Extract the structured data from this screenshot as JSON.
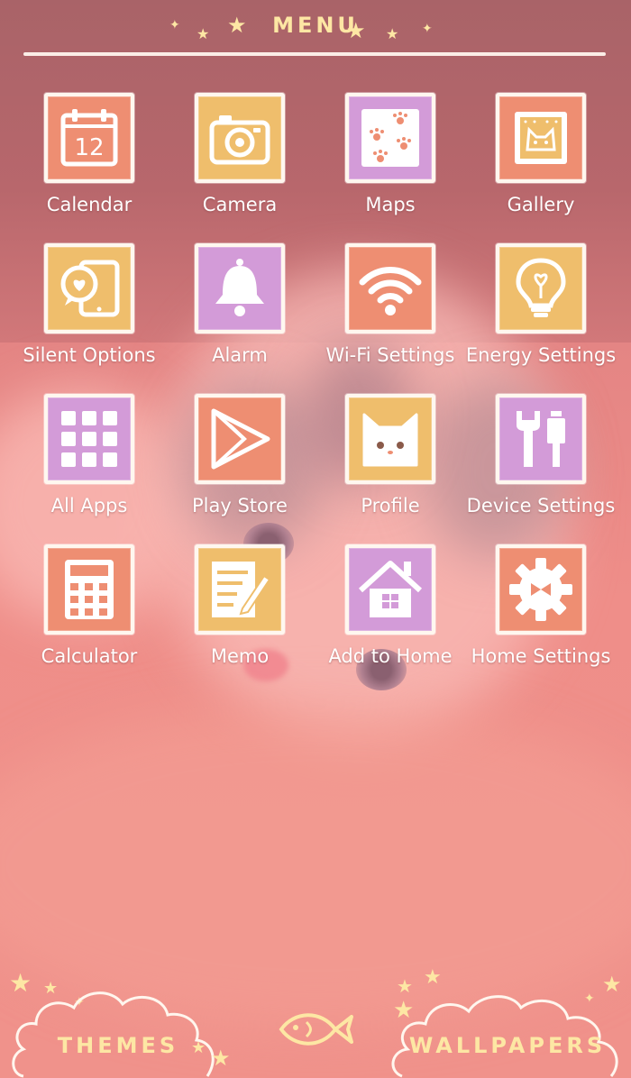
{
  "header": {
    "title": "MENU"
  },
  "apps": [
    {
      "label": "Calendar",
      "icon": "calendar-icon",
      "color": "coral"
    },
    {
      "label": "Camera",
      "icon": "camera-icon",
      "color": "yellow"
    },
    {
      "label": "Maps",
      "icon": "paw-prints-icon",
      "color": "purple"
    },
    {
      "label": "Gallery",
      "icon": "cat-picture-icon",
      "color": "coral"
    },
    {
      "label": "Silent Options",
      "icon": "phone-heart-icon",
      "color": "yellow"
    },
    {
      "label": "Alarm",
      "icon": "bell-icon",
      "color": "purple"
    },
    {
      "label": "Wi-Fi Settings",
      "icon": "wifi-icon",
      "color": "coral"
    },
    {
      "label": "Energy Settings",
      "icon": "lightbulb-icon",
      "color": "yellow"
    },
    {
      "label": "All Apps",
      "icon": "app-grid-icon",
      "color": "purple"
    },
    {
      "label": "Play Store",
      "icon": "play-store-icon",
      "color": "coral"
    },
    {
      "label": "Profile",
      "icon": "cat-face-icon",
      "color": "yellow"
    },
    {
      "label": "Device Settings",
      "icon": "tools-icon",
      "color": "purple"
    },
    {
      "label": "Calculator",
      "icon": "calculator-icon",
      "color": "coral"
    },
    {
      "label": "Memo",
      "icon": "memo-pencil-icon",
      "color": "yellow"
    },
    {
      "label": "Add to Home",
      "icon": "house-icon",
      "color": "purple"
    },
    {
      "label": "Home Settings",
      "icon": "gear-icon",
      "color": "coral"
    }
  ],
  "calendar_date": "12",
  "footer": {
    "themes_label": "THEMES",
    "wallpapers_label": "WALLPAPERS"
  },
  "colors": {
    "coral": "#ee8e72",
    "yellow": "#efbe6c",
    "purple": "#d39bd8",
    "accent": "#fde7a4"
  }
}
